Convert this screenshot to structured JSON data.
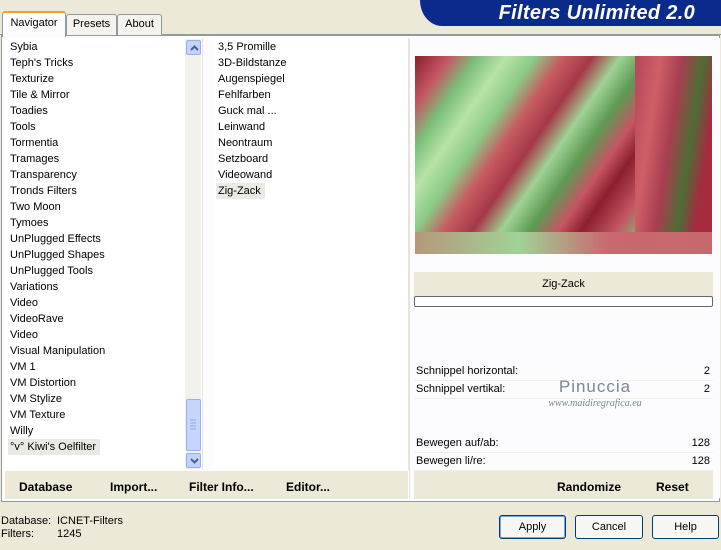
{
  "tabs": [
    "Navigator",
    "Presets",
    "About"
  ],
  "banner_title": "Filters Unlimited 2.0",
  "categories": [
    "Sybia",
    "Teph's Tricks",
    "Texturize",
    "Tile & Mirror",
    "Toadies",
    "Tools",
    "Tormentia",
    "Tramages",
    "Transparency",
    "Tronds Filters",
    "Two Moon",
    "Tymoes",
    "UnPlugged Effects",
    "UnPlugged Shapes",
    "UnPlugged Tools",
    "Variations",
    "Video",
    "VideoRave",
    "Video",
    "Visual Manipulation",
    "VM 1",
    "VM Distortion",
    "VM Stylize",
    "VM Texture",
    "Willy",
    "°v° Kiwi's Oelfilter"
  ],
  "selected_category": "°v° Kiwi's Oelfilter",
  "filters": [
    "3,5 Promille",
    "3D-Bildstanze",
    "Augenspiegel",
    "Fehlfarben",
    "Guck mal ...",
    "Leinwand",
    "Neontraum",
    "Setzboard",
    "Videowand",
    "Zig-Zack"
  ],
  "selected_filter": "Zig-Zack",
  "preview_caption": "Zig-Zack",
  "params": [
    {
      "label": "Schnippel horizontal:",
      "value": "2"
    },
    {
      "label": "Schnippel vertikal:",
      "value": "2"
    },
    {
      "label": "Bewegen auf/ab:",
      "value": "128"
    },
    {
      "label": "Bewegen li/re:",
      "value": "128"
    }
  ],
  "watermark": {
    "name": "Pinuccia",
    "url": "www.maidiregrafica.eu"
  },
  "links": {
    "database": "Database",
    "import": "Import...",
    "filter_info": "Filter Info...",
    "editor": "Editor...",
    "randomize": "Randomize",
    "reset": "Reset"
  },
  "status": {
    "database_label": "Database:",
    "database_value": "ICNET-Filters",
    "filters_label": "Filters:",
    "filters_value": "1245"
  },
  "buttons": {
    "apply": "Apply",
    "cancel": "Cancel",
    "help": "Help"
  },
  "colors": {
    "banner": "#0a2a8c",
    "tab_highlight": "#f0a030",
    "button_border": "#003c74"
  }
}
